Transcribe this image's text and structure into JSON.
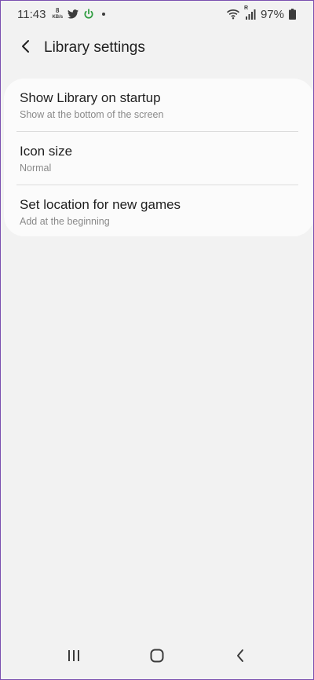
{
  "status_bar": {
    "time": "11:43",
    "net_speed_value": "8",
    "net_speed_unit": "KB/s",
    "battery_percent": "97%",
    "roaming_indicator": "R",
    "icons": [
      "twitter-icon",
      "power-icon",
      "notification-dot",
      "wifi-icon",
      "signal-icon",
      "battery-icon"
    ]
  },
  "header": {
    "title": "Library settings",
    "back_icon": "back-arrow-icon"
  },
  "settings": [
    {
      "title": "Show Library on startup",
      "summary": "Show at the bottom of the screen"
    },
    {
      "title": "Icon size",
      "summary": "Normal"
    },
    {
      "title": "Set location for new games",
      "summary": "Add at the beginning"
    }
  ],
  "nav_bar": {
    "icons": [
      "recent-apps-icon",
      "home-icon",
      "nav-back-icon"
    ]
  },
  "colors": {
    "background": "#f2f2f2",
    "card": "#fbfbfb",
    "title_text": "#1f1f1f",
    "summary_text": "#8a8a8a",
    "power_icon": "#2e9c3f",
    "frame_border": "#7a4fb0"
  }
}
